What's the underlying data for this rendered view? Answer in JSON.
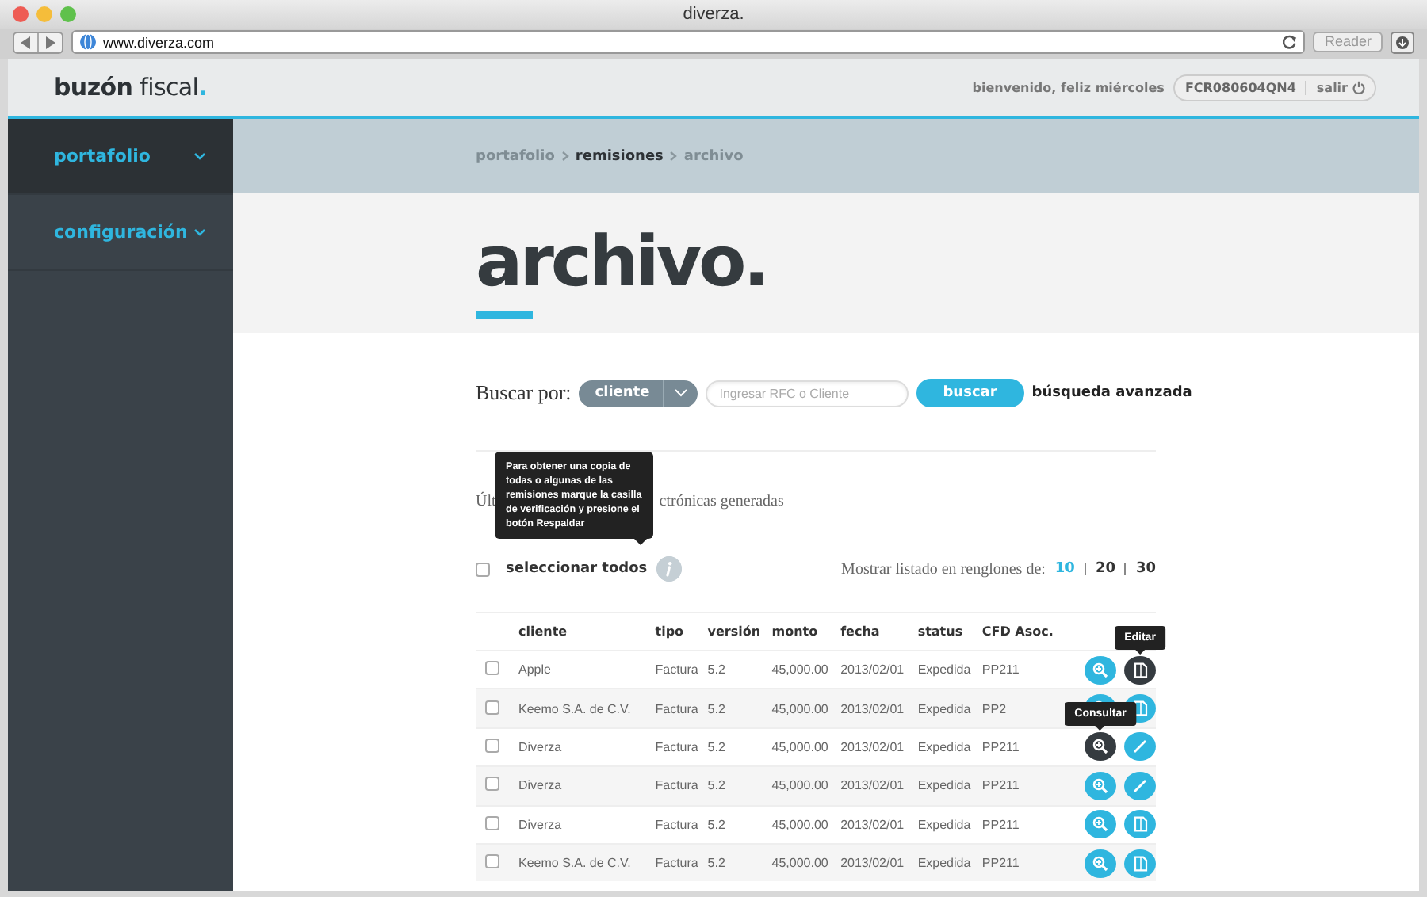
{
  "browser": {
    "title": "diverza.",
    "url": "www.diverza.com",
    "reader": "Reader"
  },
  "header": {
    "logo_bold": "buzón",
    "logo_light": "fiscal",
    "logo_dot": ".",
    "greeting": "bienvenido, feliz miércoles",
    "rfc": "FCR080604QN4",
    "logout": "salir"
  },
  "sidebar": {
    "items": [
      {
        "label": "portafolio",
        "selected": true
      },
      {
        "label": "configuración",
        "selected": false
      }
    ]
  },
  "breadcrumb": [
    {
      "label": "portafolio",
      "current": false
    },
    {
      "label": "remisiones",
      "current": true
    },
    {
      "label": "archivo",
      "current": false
    }
  ],
  "page_title": "archivo.",
  "search": {
    "label": "Buscar por:",
    "filter": "cliente",
    "placeholder": "Ingresar RFC o Cliente",
    "button": "buscar",
    "advanced": "búsqueda avanzada"
  },
  "heading_start": "Últ",
  "heading_end": "ctrónicas generadas",
  "help_tooltip": "Para obtener una copia de todas o algunas de las remisiones marque la casilla de verificación y presione el botón **Respaldar**",
  "select_all": {
    "label": "seleccionar todos",
    "checked": false
  },
  "page_size": {
    "label": "Mostrar listado en renglones de:",
    "options": [
      {
        "label": "10",
        "selected": true
      },
      {
        "label": "20",
        "selected": false
      },
      {
        "label": "30",
        "selected": false
      }
    ]
  },
  "table": {
    "columns": [
      "cliente",
      "tipo",
      "versión",
      "monto",
      "fecha",
      "status",
      "CFD Asoc."
    ],
    "rows": [
      {
        "checked": false,
        "cells": [
          "Apple",
          "Factura",
          "5.2",
          "45,000.00",
          "2013/02/01",
          "Expedida",
          "PP211"
        ],
        "actions": [
          {
            "kind": "view",
            "hover": false
          },
          {
            "kind": "document",
            "hover": true,
            "tooltip": "Editar"
          }
        ]
      },
      {
        "checked": false,
        "cells": [
          "Keemo S.A. de C.V.",
          "Factura",
          "5.2",
          "45,000.00",
          "2013/02/01",
          "Expedida",
          "PP2"
        ],
        "actions": [
          {
            "kind": "view",
            "hover": false
          },
          {
            "kind": "document",
            "hover": false
          }
        ]
      },
      {
        "checked": false,
        "cells": [
          "Diverza",
          "Factura",
          "5.2",
          "45,000.00",
          "2013/02/01",
          "Expedida",
          "PP211"
        ],
        "actions": [
          {
            "kind": "view",
            "hover": true,
            "tooltip": "Consultar"
          },
          {
            "kind": "pencil",
            "hover": false
          }
        ]
      },
      {
        "checked": false,
        "cells": [
          "Diverza",
          "Factura",
          "5.2",
          "45,000.00",
          "2013/02/01",
          "Expedida",
          "PP211"
        ],
        "actions": [
          {
            "kind": "view",
            "hover": false
          },
          {
            "kind": "pencil",
            "hover": false
          }
        ]
      },
      {
        "checked": false,
        "cells": [
          "Diverza",
          "Factura",
          "5.2",
          "45,000.00",
          "2013/02/01",
          "Expedida",
          "PP211"
        ],
        "actions": [
          {
            "kind": "view",
            "hover": false
          },
          {
            "kind": "document",
            "hover": false
          }
        ]
      },
      {
        "checked": false,
        "cells": [
          "Keemo S.A. de C.V.",
          "Factura",
          "5.2",
          "45,000.00",
          "2013/02/01",
          "Expedida",
          "PP211"
        ],
        "actions": [
          {
            "kind": "view",
            "hover": false
          },
          {
            "kind": "document",
            "hover": false
          }
        ]
      }
    ]
  }
}
